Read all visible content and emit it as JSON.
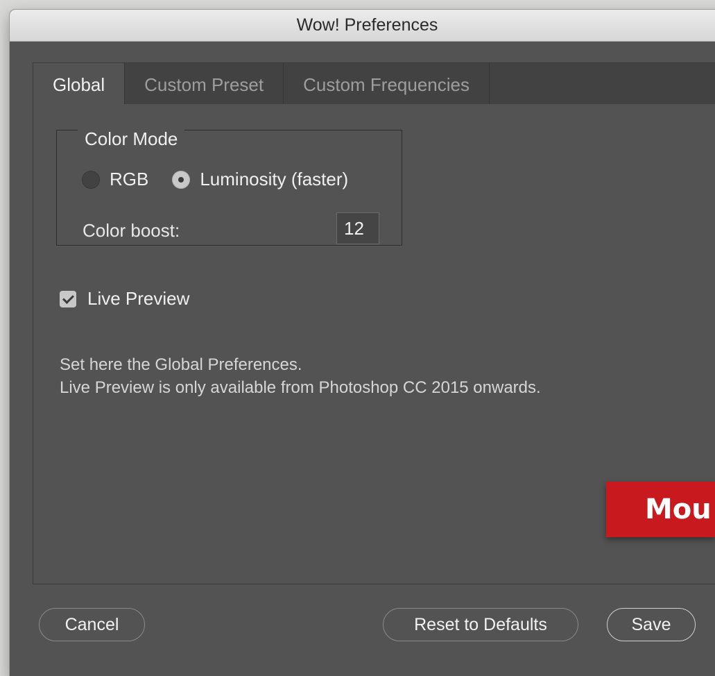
{
  "window": {
    "title": "Wow! Preferences"
  },
  "tabs": [
    {
      "label": "Global",
      "active": true
    },
    {
      "label": "Custom Preset",
      "active": false
    },
    {
      "label": "Custom Frequencies",
      "active": false
    }
  ],
  "color_mode": {
    "title": "Color Mode",
    "options": [
      {
        "label": "RGB",
        "selected": false
      },
      {
        "label": "Luminosity (faster)",
        "selected": true
      }
    ],
    "boost_label": "Color boost:",
    "boost_value": "12"
  },
  "live_preview": {
    "label": "Live Preview",
    "checked": true
  },
  "info": {
    "line1": "Set here the Global Preferences.",
    "line2": "Live Preview is only available from Photoshop CC 2015 onwards."
  },
  "buttons": {
    "cancel": "Cancel",
    "reset": "Reset to Defaults",
    "save": "Save"
  },
  "watermark": {
    "text": "Mou"
  },
  "colors": {
    "panel_bg": "#535353",
    "tabbar_bg": "#424242",
    "watermark_bg": "#c8191e"
  }
}
